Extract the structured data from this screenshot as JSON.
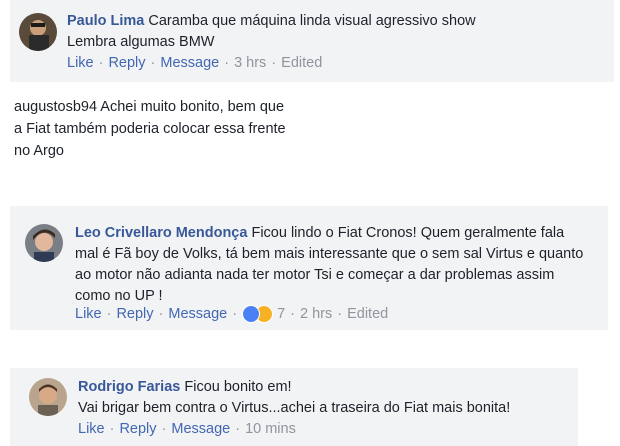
{
  "comments": [
    {
      "name": "Paulo Lima",
      "text_line1": "Caramba que máquina linda visual agressivo show",
      "text_line2": "Lembra algumas BMW",
      "like": "Like",
      "reply": "Reply",
      "message": "Message",
      "time": "3 hrs",
      "edited": "Edited"
    },
    {
      "name": "Leo Crivellaro Mendonça",
      "text_line1": "Ficou lindo o Fiat Cronos! Quem geralmente fala",
      "text_line2": "mal é Fã boy de Volks, tá bem mais interessante que o sem sal Virtus e quanto",
      "text_line3": "ao motor não adianta nada ter motor Tsi e começar a dar problemas assim",
      "text_line4": "como no UP !",
      "like": "Like",
      "reply": "Reply",
      "message": "Message",
      "reaction_count": "7",
      "time": "2 hrs",
      "edited": "Edited"
    },
    {
      "name": "Rodrigo Farias",
      "text_line1": "Ficou bonito em!",
      "text_line2": "Vai brigar bem contra o Virtus...achei a traseira do Fiat mais bonita!",
      "like": "Like",
      "reply": "Reply",
      "message": "Message",
      "time": "10 mins"
    }
  ],
  "instagram_comment": {
    "line1": "augustosb94 Achei muito bonito, bem que",
    "line2": "a Fiat também poderia colocar essa frente",
    "line3": "no Argo"
  },
  "colors": {
    "link": "#4267b2",
    "name": "#385898",
    "bubble": "#f2f3f5",
    "muted": "#90949c"
  }
}
